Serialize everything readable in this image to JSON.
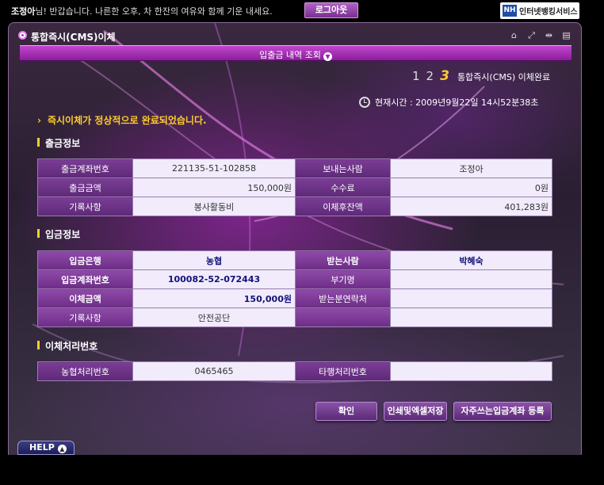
{
  "topbar": {
    "user_name": "조정아",
    "greeting": "님! 반갑습니다. 나른한 오후, 차 한잔의 여유와 함께 기운 내세요.",
    "logout_label": "로그아웃",
    "brand_mark": "NH",
    "brand_text": "인터넷뱅킹서비스"
  },
  "header": {
    "title": "통합즉시(CMS)이체",
    "tool_icons": [
      "mouse-icon",
      "expand-icon",
      "resize-icon",
      "print-icon"
    ]
  },
  "subbar": {
    "label": "입출금 내역 조회"
  },
  "steps": {
    "items": [
      "1",
      "2",
      "3"
    ],
    "active": "3",
    "label": "통합즉시(CMS) 이체완료"
  },
  "clock": {
    "text": "현재시간 : 2009년9월22일 14시52분38초"
  },
  "done_message": "즉시이체가 정상적으로 완료되었습니다.",
  "withdraw": {
    "section_title": "출금정보",
    "rows": [
      [
        "출금계좌번호",
        "221135-51-102858",
        "보내는사람",
        "조정아"
      ],
      [
        "출금금액",
        "150,000원",
        "수수료",
        "0원"
      ],
      [
        "기록사항",
        "봉사활동비",
        "이체후잔액",
        "401,283원"
      ]
    ]
  },
  "deposit": {
    "section_title": "입금정보",
    "rows": [
      [
        "입금은행",
        "농협",
        "받는사람",
        "박혜숙"
      ],
      [
        "입금계좌번호",
        "100082-52-072443",
        "부기명",
        ""
      ],
      [
        "이체금액",
        "150,000원",
        "받는분연락처",
        ""
      ],
      [
        "기록사항",
        "안전공단",
        "",
        ""
      ]
    ]
  },
  "processing": {
    "section_title": "이체처리번호",
    "rows": [
      [
        "농협처리번호",
        "0465465",
        "타행처리번호",
        ""
      ]
    ]
  },
  "buttons": {
    "confirm": "확인",
    "print_excel": "인쇄및엑셀저장",
    "register_frequent": "자주쓰는입금계좌 등록"
  },
  "help": {
    "label": "HELP"
  },
  "colors": {
    "accent": "#b03bbd",
    "highlight": "#ffcc2b",
    "cell_bg": "#f1ebfb",
    "label_bg": "#6c2d86"
  }
}
